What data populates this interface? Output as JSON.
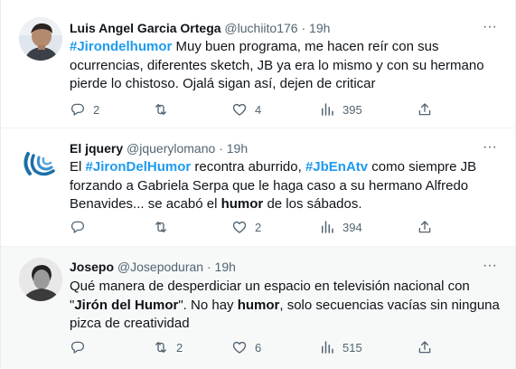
{
  "tweets": [
    {
      "name": "Luis Angel Garcia Ortega",
      "handle": "@luchiito176",
      "dot": "·",
      "time": "19h",
      "more": "···",
      "text": [
        {
          "t": "#Jirondelhumor",
          "s": "tag"
        },
        {
          "t": " Muy buen programa, me hacen reír con sus ocurrencias, diferentes sketch, JB ya era lo mismo y con su hermano pierde lo chistoso. Ojalá sigan así,  dejen de criticar",
          "s": ""
        }
      ],
      "replies": "2",
      "retweets": "",
      "likes": "4",
      "views": "395"
    },
    {
      "name": "El jquery",
      "handle": "@jquerylomano",
      "dot": "·",
      "time": "19h",
      "more": "···",
      "text": [
        {
          "t": "El ",
          "s": ""
        },
        {
          "t": "#JironDelHumor",
          "s": "tag"
        },
        {
          "t": " recontra aburrido, ",
          "s": ""
        },
        {
          "t": "#JbEnAtv",
          "s": "tag"
        },
        {
          "t": " como siempre JB forzando a Gabriela Serpa que le haga caso a su hermano Alfredo Benavides... se acabó el ",
          "s": ""
        },
        {
          "t": "humor",
          "s": "bold"
        },
        {
          "t": " de los sábados.",
          "s": ""
        }
      ],
      "replies": "",
      "retweets": "",
      "likes": "2",
      "views": "394"
    },
    {
      "name": "Josepo",
      "handle": "@Josepoduran",
      "dot": "·",
      "time": "19h",
      "more": "···",
      "text": [
        {
          "t": "Qué manera de desperdiciar un espacio en televisión nacional con \"",
          "s": ""
        },
        {
          "t": "Jirón del Humor",
          "s": "bold"
        },
        {
          "t": "\". No hay ",
          "s": ""
        },
        {
          "t": "humor",
          "s": "bold"
        },
        {
          "t": ", solo secuencias vacías sin ninguna pizca de creatividad",
          "s": ""
        }
      ],
      "replies": "",
      "retweets": "2",
      "likes": "6",
      "views": "515"
    }
  ],
  "colors": {
    "accent": "#1d9bf0",
    "muted": "#536471",
    "text": "#0f1419"
  },
  "icons": [
    "reply-icon",
    "retweet-icon",
    "like-icon",
    "views-icon",
    "share-icon",
    "more-icon"
  ]
}
